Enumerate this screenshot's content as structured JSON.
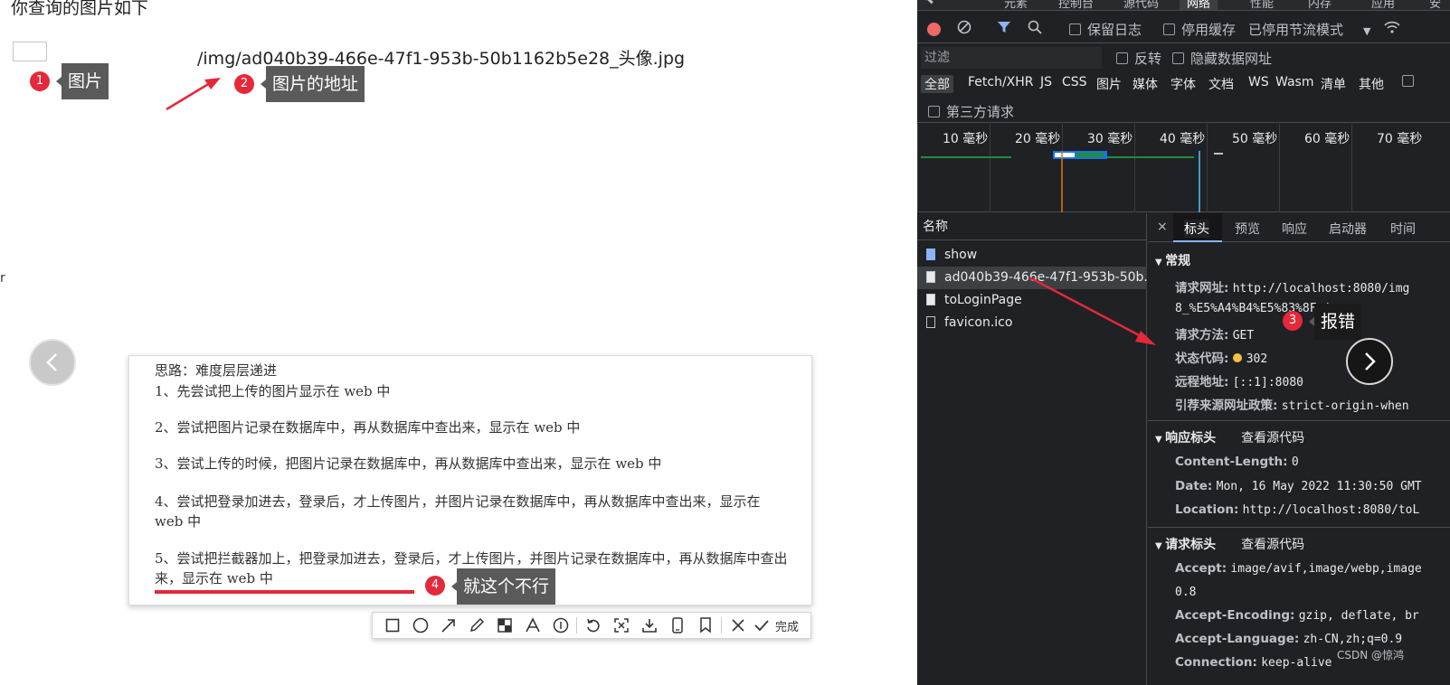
{
  "page": {
    "heading": "你查询的图片如下",
    "image_path": "/img/ad040b39-466e-47f1-953b-50b1162b5e28_头像.jpg"
  },
  "annotations": [
    {
      "number": "1",
      "label": "图片"
    },
    {
      "number": "2",
      "label": "图片的地址"
    },
    {
      "number": "3",
      "label": "报错"
    },
    {
      "number": "4",
      "label": "就这个不行"
    }
  ],
  "note": {
    "intro": "思路：难度层层递进",
    "steps": [
      "1、先尝试把上传的图片显示在 web 中",
      "2、尝试把图片记录在数据库中，再从数据库中查出来，显示在 web 中",
      "3、尝试上传的时候，把图片记录在数据库中，再从数据库中查出来，显示在 web 中",
      "4、尝试把登录加进去，登录后，才上传图片，并图片记录在数据库中，再从数据库中查出来，显示在 web 中",
      "5、尝试把拦截器加上，把登录加进去，登录后，才上传图片，并图片记录在数据库中，再从数据库中查出来，显示在 web 中"
    ]
  },
  "screenshot_toolbar": {
    "tools": [
      "rect-tool",
      "ellipse-tool",
      "arrow-tool",
      "pen-tool",
      "mosaic-tool",
      "text-tool",
      "number-tool",
      "undo",
      "pin",
      "download",
      "phone",
      "bookmark",
      "close"
    ],
    "done_label": "完成"
  },
  "devtools": {
    "tabs": [
      "元素",
      "控制台",
      "源代码",
      "网络",
      "性能",
      "内存",
      "应用",
      "安"
    ],
    "active_tab": "网络",
    "controls": {
      "preserve_log": "保留日志",
      "disable_cache": "停用缓存",
      "throttling": "已停用节流模式"
    },
    "filter": {
      "placeholder": "过滤",
      "invert": "反转",
      "hide_data_urls": "隐藏数据网址"
    },
    "type_filters": [
      "全部",
      "Fetch/XHR",
      "JS",
      "CSS",
      "图片",
      "媒体",
      "字体",
      "文档",
      "WS",
      "Wasm",
      "清单",
      "其他"
    ],
    "third_party": "第三方请求",
    "timeline_ticks": [
      "10 毫秒",
      "20 毫秒",
      "30 毫秒",
      "40 毫秒",
      "50 毫秒",
      "60 毫秒",
      "70 毫秒"
    ],
    "name_header": "名称",
    "requests": [
      "show",
      "ad040b39-466e-47f1-953b-50b...",
      "toLoginPage",
      "favicon.ico"
    ],
    "detail_tabs": [
      "标头",
      "预览",
      "响应",
      "启动器",
      "时间"
    ],
    "general": {
      "title": "常规",
      "request_url_key": "请求网址:",
      "request_url": "http://localhost:8080/img",
      "request_url_cont": "8_%E5%A4%B4%E5%83%8F.jpg",
      "method_key": "请求方法:",
      "method": "GET",
      "status_key": "状态代码:",
      "status": "302",
      "remote_key": "远程地址:",
      "remote": "[::1]:8080",
      "referrer_key": "引荐来源网址政策:",
      "referrer": "strict-origin-when"
    },
    "response_headers": {
      "title": "响应标头",
      "view_source": "查看源代码",
      "content_length_key": "Content-Length:",
      "content_length": "0",
      "date_key": "Date:",
      "date": "Mon, 16 May 2022 11:30:50 GMT",
      "location_key": "Location:",
      "location": "http://localhost:8080/toL"
    },
    "request_headers": {
      "title": "请求标头",
      "view_source": "查看源代码",
      "accept_key": "Accept:",
      "accept": "image/avif,image/webp,image",
      "accept_cont": "0.8",
      "encoding_key": "Accept-Encoding:",
      "encoding": "gzip, deflate, br",
      "language_key": "Accept-Language:",
      "language": "zh-CN,zh;q=0.9",
      "connection_key": "Connection:",
      "connection": "keep-alive"
    }
  },
  "watermark": "CSDN @惊鸿",
  "colors": {
    "annotation_red": "#e5283a",
    "callout_gray": "#5a5a5a",
    "devtools_bg": "#202124",
    "status_yellow": "#f9c23c"
  }
}
